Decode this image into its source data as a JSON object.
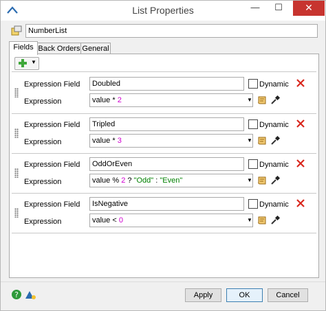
{
  "window": {
    "title": "List Properties",
    "min_glyph": "—",
    "max_glyph": "☐",
    "close_glyph": "✕"
  },
  "object_name": "NumberList",
  "tabs": [
    {
      "label": "Fields"
    },
    {
      "label": "Back Orders"
    },
    {
      "label": "General"
    }
  ],
  "labels": {
    "expression_field": "Expression Field",
    "expression": "Expression",
    "dynamic": "Dynamic"
  },
  "fields": [
    {
      "name": "Doubled",
      "expr": [
        {
          "t": "value * "
        },
        {
          "t": "2",
          "c": "num"
        }
      ]
    },
    {
      "name": "Tripled",
      "expr": [
        {
          "t": "value * "
        },
        {
          "t": "3",
          "c": "num"
        }
      ]
    },
    {
      "name": "OddOrEven",
      "expr": [
        {
          "t": "value % "
        },
        {
          "t": "2",
          "c": "num"
        },
        {
          "t": " ? "
        },
        {
          "t": "\"Odd\"",
          "c": "str"
        },
        {
          "t": " : "
        },
        {
          "t": "\"Even\"",
          "c": "str"
        }
      ]
    },
    {
      "name": "IsNegative",
      "expr": [
        {
          "t": "value < "
        },
        {
          "t": "0",
          "c": "num"
        }
      ]
    }
  ],
  "buttons": {
    "apply": "Apply",
    "ok": "OK",
    "cancel": "Cancel"
  },
  "colors": {
    "close": "#c7342f",
    "delete": "#d9261c",
    "number": "#d000d0",
    "string": "#008000"
  }
}
